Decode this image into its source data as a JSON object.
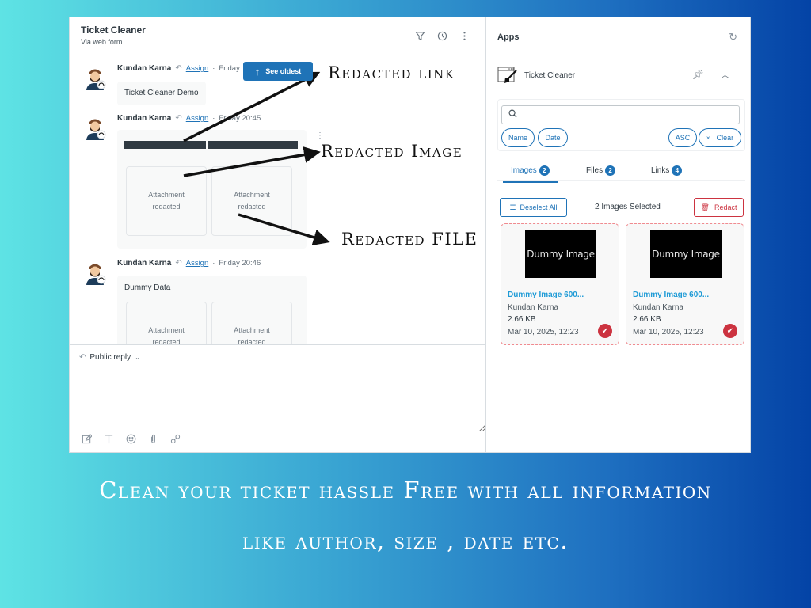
{
  "ticket": {
    "title": "Ticket Cleaner",
    "channel": "Via web form",
    "header_icons": [
      "filter-icon",
      "history-icon",
      "more-vertical-icon"
    ],
    "see_oldest_label": "See oldest",
    "messages": [
      {
        "author": "Kundan Karna",
        "assign_label": "Assign",
        "separator": "·",
        "timestamp": "Friday",
        "body": "Ticket Cleaner Demo"
      },
      {
        "author": "Kundan Karna",
        "assign_label": "Assign",
        "separator": "·",
        "timestamp": "Friday 20:45",
        "body": "",
        "attachments": [
          {
            "line1": "Attachment",
            "line2": "redacted"
          },
          {
            "line1": "Attachment",
            "line2": "redacted"
          }
        ]
      },
      {
        "author": "Kundan Karna",
        "assign_label": "Assign",
        "separator": "·",
        "timestamp": "Friday 20:46",
        "body": "Dummy Data",
        "attachments": [
          {
            "line1": "Attachment",
            "line2": "redacted"
          },
          {
            "line1": "Attachment",
            "line2": "redacted"
          }
        ]
      }
    ],
    "reply": {
      "type_label": "Public reply",
      "value": "",
      "tools": [
        "compose-icon",
        "text-format-icon",
        "emoji-icon",
        "attachment-icon",
        "link-icon"
      ]
    }
  },
  "apps": {
    "title": "Apps",
    "app_name": "Ticket Cleaner",
    "search": {
      "value": "",
      "placeholder": ""
    },
    "sort_pills": {
      "name": "Name",
      "date": "Date",
      "order": "ASC",
      "clear": "Clear"
    },
    "tabs": [
      {
        "label": "Images",
        "count": "2",
        "active": true
      },
      {
        "label": "Files",
        "count": "2",
        "active": false
      },
      {
        "label": "Links",
        "count": "4",
        "active": false
      }
    ],
    "deselect_label": "Deselect All",
    "selected_text": "2 Images Selected",
    "redact_label": "Redact",
    "items": [
      {
        "thumb_text": "Dummy Image",
        "name": "Dummy Image 600...",
        "author": "Kundan Karna",
        "size": "2.66 KB",
        "date": "Mar 10, 2025, 12:23",
        "selected": true
      },
      {
        "thumb_text": "Dummy Image",
        "name": "Dummy Image 600...",
        "author": "Kundan Karna",
        "size": "2.66 KB",
        "date": "Mar 10, 2025, 12:23",
        "selected": true
      }
    ],
    "colors": {
      "accent": "#1f73b7",
      "danger": "#cc3340",
      "link": "#1f9bd6"
    }
  },
  "annotations": {
    "link": "Redacted link",
    "image": "Redacted Image",
    "file": "Redacted FILE"
  },
  "caption": {
    "line1": "Clean your ticket hassle Free with all information",
    "line2": "like author, size , date etc."
  },
  "background": {
    "gradient_start": "#5ee3e4",
    "gradient_end": "#0443a6"
  }
}
